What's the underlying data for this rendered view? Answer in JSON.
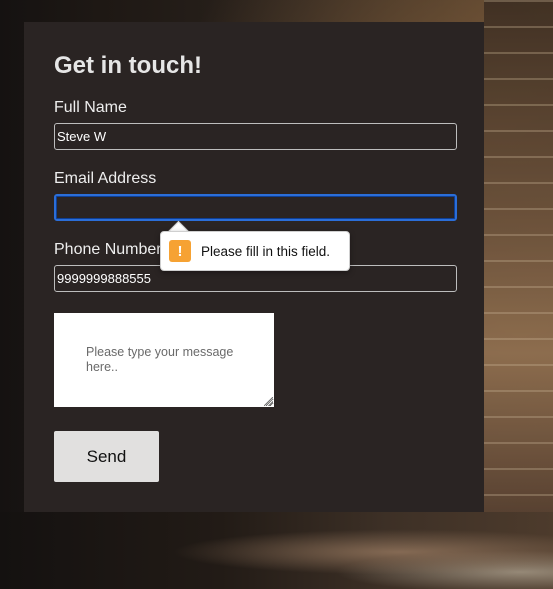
{
  "form": {
    "title": "Get in touch!",
    "full_name": {
      "label": "Full Name",
      "value": "Steve W"
    },
    "email": {
      "label": "Email Address",
      "value": ""
    },
    "phone": {
      "label": "Phone Number",
      "value": "9999999888555"
    },
    "message": {
      "placeholder": "Please type your message here..",
      "value": ""
    },
    "send_label": "Send"
  },
  "validation_tooltip": {
    "icon": "warning-icon",
    "icon_glyph": "!",
    "text": "Please fill in this field.",
    "icon_color": "#f6a233"
  },
  "colors": {
    "card_background": "#2a2423",
    "focus_ring": "#2b6ed8",
    "button_background": "#e1e0df"
  }
}
